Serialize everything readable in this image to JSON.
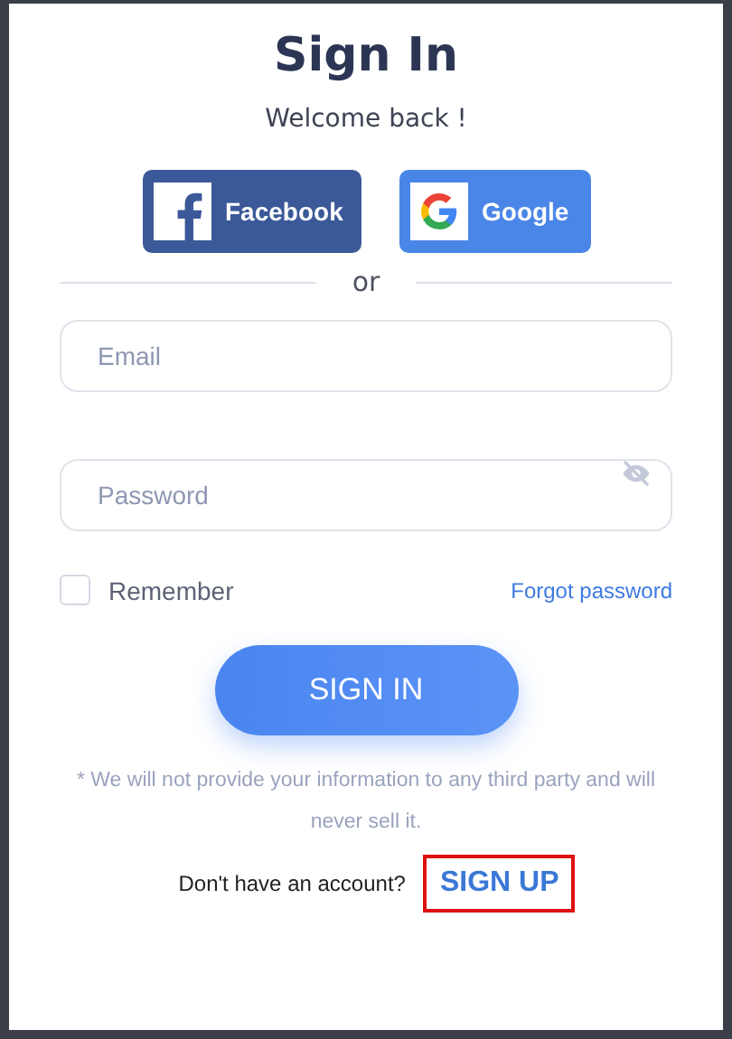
{
  "title": "Sign In",
  "subtitle": "Welcome back !",
  "social_buttons": [
    {
      "kind": "facebook",
      "label": "Facebook"
    },
    {
      "kind": "google",
      "label": "Google"
    }
  ],
  "divider": "or",
  "email": {
    "placeholder": "Email"
  },
  "password": {
    "placeholder": "Password"
  },
  "remember": {
    "label": "Remember",
    "checked": false
  },
  "forgot_link": "Forgot password",
  "submit": "SIGN IN",
  "disclaimer": "* We will not provide your information to any third party and will never sell it.",
  "signup": {
    "prompt": "Don't have an account?",
    "link": "SIGN UP",
    "highlighted": true
  }
}
